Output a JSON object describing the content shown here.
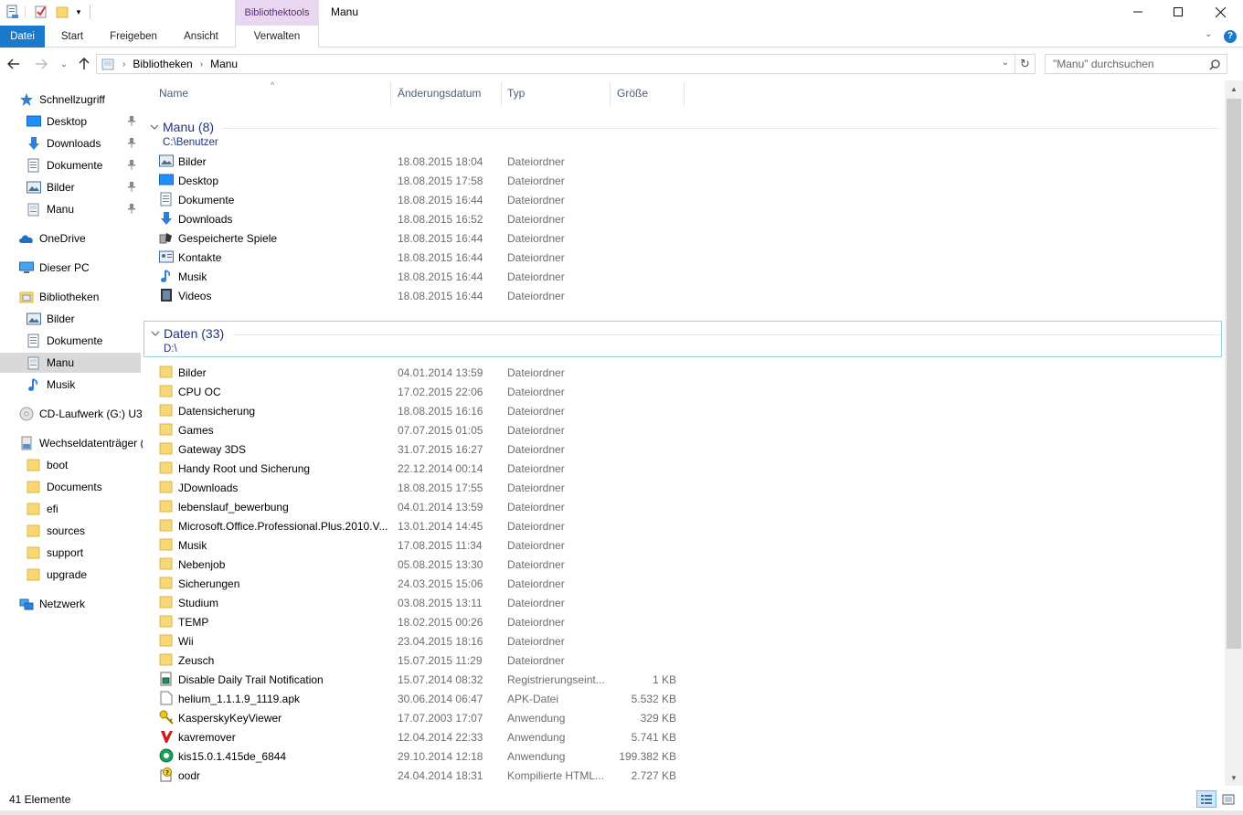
{
  "window": {
    "title": "Manu",
    "context_tab_title": "Bibliothektools"
  },
  "ribbon": {
    "tabs": [
      "Datei",
      "Start",
      "Freigeben",
      "Ansicht",
      "Verwalten"
    ]
  },
  "address": {
    "path": [
      "Bibliotheken",
      "Manu"
    ],
    "search_placeholder": "\"Manu\" durchsuchen"
  },
  "sidebar": {
    "items": [
      {
        "label": "Schnellzugriff",
        "icon": "star-icon",
        "pinned": false,
        "level": 0
      },
      {
        "label": "Desktop",
        "icon": "desktop-icon",
        "pinned": true,
        "level": 1
      },
      {
        "label": "Downloads",
        "icon": "download-icon",
        "pinned": true,
        "level": 1
      },
      {
        "label": "Dokumente",
        "icon": "document-icon",
        "pinned": true,
        "level": 1
      },
      {
        "label": "Bilder",
        "icon": "pictures-icon",
        "pinned": true,
        "level": 1
      },
      {
        "label": "Manu",
        "icon": "library-icon",
        "pinned": true,
        "level": 1
      },
      {
        "label": "OneDrive",
        "icon": "cloud-icon",
        "pinned": false,
        "level": 0
      },
      {
        "label": "Dieser PC",
        "icon": "computer-icon",
        "pinned": false,
        "level": 0
      },
      {
        "label": "Bibliotheken",
        "icon": "libraries-icon",
        "pinned": false,
        "level": 0
      },
      {
        "label": "Bilder",
        "icon": "pictures-icon",
        "pinned": false,
        "level": 1
      },
      {
        "label": "Dokumente",
        "icon": "document-icon",
        "pinned": false,
        "level": 1
      },
      {
        "label": "Manu",
        "icon": "library-icon",
        "pinned": false,
        "level": 1,
        "selected": true
      },
      {
        "label": "Musik",
        "icon": "music-icon",
        "pinned": false,
        "level": 1
      },
      {
        "label": "CD-Laufwerk (G:) U3",
        "icon": "cd-drive-icon",
        "pinned": false,
        "level": 0
      },
      {
        "label": "Wechseldatenträger (",
        "icon": "usb-drive-icon",
        "pinned": false,
        "level": 0
      },
      {
        "label": "boot",
        "icon": "folder-icon",
        "pinned": false,
        "level": 1
      },
      {
        "label": "Documents",
        "icon": "folder-icon",
        "pinned": false,
        "level": 1
      },
      {
        "label": "efi",
        "icon": "folder-icon",
        "pinned": false,
        "level": 1
      },
      {
        "label": "sources",
        "icon": "folder-icon",
        "pinned": false,
        "level": 1
      },
      {
        "label": "support",
        "icon": "folder-icon",
        "pinned": false,
        "level": 1
      },
      {
        "label": "upgrade",
        "icon": "folder-icon",
        "pinned": false,
        "level": 1
      },
      {
        "label": "Netzwerk",
        "icon": "network-icon",
        "pinned": false,
        "level": 0
      }
    ]
  },
  "columns": [
    "Name",
    "Änderungsdatum",
    "Typ",
    "Größe"
  ],
  "groups": [
    {
      "title": "Manu (8)",
      "path": "C:\\Benutzer",
      "rows": [
        {
          "name": "Bilder",
          "date": "18.08.2015 18:04",
          "type": "Dateiordner",
          "size": "",
          "icon": "pictures-icon"
        },
        {
          "name": "Desktop",
          "date": "18.08.2015 17:58",
          "type": "Dateiordner",
          "size": "",
          "icon": "desktop-icon"
        },
        {
          "name": "Dokumente",
          "date": "18.08.2015 16:44",
          "type": "Dateiordner",
          "size": "",
          "icon": "document-icon"
        },
        {
          "name": "Downloads",
          "date": "18.08.2015 16:52",
          "type": "Dateiordner",
          "size": "",
          "icon": "download-icon"
        },
        {
          "name": "Gespeicherte Spiele",
          "date": "18.08.2015 16:44",
          "type": "Dateiordner",
          "size": "",
          "icon": "saved-games-icon"
        },
        {
          "name": "Kontakte",
          "date": "18.08.2015 16:44",
          "type": "Dateiordner",
          "size": "",
          "icon": "contacts-icon"
        },
        {
          "name": "Musik",
          "date": "18.08.2015 16:44",
          "type": "Dateiordner",
          "size": "",
          "icon": "music-icon"
        },
        {
          "name": "Videos",
          "date": "18.08.2015 16:44",
          "type": "Dateiordner",
          "size": "",
          "icon": "video-icon"
        }
      ]
    },
    {
      "title": "Daten (33)",
      "path": "D:\\",
      "rows": [
        {
          "name": "Bilder",
          "date": "04.01.2014 13:59",
          "type": "Dateiordner",
          "size": "",
          "icon": "folder-icon"
        },
        {
          "name": "CPU OC",
          "date": "17.02.2015 22:06",
          "type": "Dateiordner",
          "size": "",
          "icon": "folder-icon"
        },
        {
          "name": "Datensicherung",
          "date": "18.08.2015 16:16",
          "type": "Dateiordner",
          "size": "",
          "icon": "folder-icon"
        },
        {
          "name": "Games",
          "date": "07.07.2015 01:05",
          "type": "Dateiordner",
          "size": "",
          "icon": "folder-icon"
        },
        {
          "name": "Gateway 3DS",
          "date": "31.07.2015 16:27",
          "type": "Dateiordner",
          "size": "",
          "icon": "folder-icon"
        },
        {
          "name": "Handy Root und Sicherung",
          "date": "22.12.2014 00:14",
          "type": "Dateiordner",
          "size": "",
          "icon": "folder-icon"
        },
        {
          "name": "JDownloads",
          "date": "18.08.2015 17:55",
          "type": "Dateiordner",
          "size": "",
          "icon": "folder-icon"
        },
        {
          "name": "lebenslauf_bewerbung",
          "date": "04.01.2014 13:59",
          "type": "Dateiordner",
          "size": "",
          "icon": "folder-icon"
        },
        {
          "name": "Microsoft.Office.Professional.Plus.2010.V...",
          "date": "13.01.2014 14:45",
          "type": "Dateiordner",
          "size": "",
          "icon": "folder-icon"
        },
        {
          "name": "Musik",
          "date": "17.08.2015 11:34",
          "type": "Dateiordner",
          "size": "",
          "icon": "folder-icon"
        },
        {
          "name": "Nebenjob",
          "date": "05.08.2015 13:30",
          "type": "Dateiordner",
          "size": "",
          "icon": "folder-icon"
        },
        {
          "name": "Sicherungen",
          "date": "24.03.2015 15:06",
          "type": "Dateiordner",
          "size": "",
          "icon": "folder-icon"
        },
        {
          "name": "Studium",
          "date": "03.08.2015 13:11",
          "type": "Dateiordner",
          "size": "",
          "icon": "folder-icon"
        },
        {
          "name": "TEMP",
          "date": "18.02.2015 00:26",
          "type": "Dateiordner",
          "size": "",
          "icon": "folder-icon"
        },
        {
          "name": "Wii",
          "date": "23.04.2015 18:16",
          "type": "Dateiordner",
          "size": "",
          "icon": "folder-icon"
        },
        {
          "name": "Zeusch",
          "date": "15.07.2015 11:29",
          "type": "Dateiordner",
          "size": "",
          "icon": "folder-icon"
        },
        {
          "name": "Disable Daily Trail Notification",
          "date": "15.07.2014 08:32",
          "type": "Registrierungseint...",
          "size": "1 KB",
          "icon": "registry-file-icon"
        },
        {
          "name": "helium_1.1.1.9_1119.apk",
          "date": "30.06.2014 06:47",
          "type": "APK-Datei",
          "size": "5.532 KB",
          "icon": "file-icon"
        },
        {
          "name": "KasperskyKeyViewer",
          "date": "17.07.2003 17:07",
          "type": "Anwendung",
          "size": "329 KB",
          "icon": "key-app-icon"
        },
        {
          "name": "kavremover",
          "date": "12.04.2014 22:33",
          "type": "Anwendung",
          "size": "5.741 KB",
          "icon": "kaspersky-icon"
        },
        {
          "name": "kis15.0.1.415de_6844",
          "date": "29.10.2014 12:18",
          "type": "Anwendung",
          "size": "199.382 KB",
          "icon": "installer-icon"
        },
        {
          "name": "oodr",
          "date": "24.04.2014 18:31",
          "type": "Kompilierte HTML...",
          "size": "2.727 KB",
          "icon": "help-file-icon"
        }
      ]
    }
  ],
  "status": {
    "count": "41 Elemente"
  },
  "colors": {
    "accent": "#1979ca",
    "context_tab": "#e9d6f1",
    "group_title": "#1e3287",
    "selection": "#d9d9d9"
  }
}
